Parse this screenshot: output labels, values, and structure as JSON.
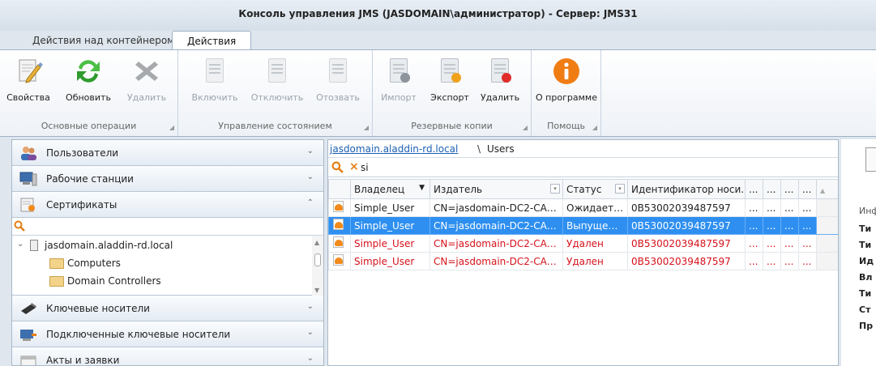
{
  "app": {
    "title": "Консоль управления JMS (JASDOMAIN\\администратор) - Сервер: JMS31"
  },
  "tabs": [
    {
      "label": "Действия над контейнером"
    },
    {
      "label": "Действия"
    }
  ],
  "ribbon": {
    "groups": [
      {
        "label": "Основные операции",
        "buttons": [
          {
            "label": "Свойства"
          },
          {
            "label": "Обновить"
          },
          {
            "label": "Удалить"
          }
        ]
      },
      {
        "label": "Управление состоянием",
        "buttons": [
          {
            "label": "Включить"
          },
          {
            "label": "Отключить"
          },
          {
            "label": "Отозвать"
          }
        ]
      },
      {
        "label": "Резервные копии",
        "buttons": [
          {
            "label": "Импорт"
          },
          {
            "label": "Экспорт"
          },
          {
            "label": "Удалить"
          }
        ]
      },
      {
        "label": "Помощь",
        "buttons": [
          {
            "label": "О программе"
          }
        ]
      }
    ]
  },
  "nav": {
    "items": [
      {
        "label": "Пользователи"
      },
      {
        "label": "Рабочие станции"
      },
      {
        "label": "Сертификаты"
      },
      {
        "label": "Ключевые носители"
      },
      {
        "label": "Подключенные ключевые носители"
      },
      {
        "label": "Акты и заявки"
      }
    ],
    "tree": {
      "root": "jasdomain.aladdin-rd.local",
      "children": [
        "Computers",
        "Domain Controllers"
      ]
    }
  },
  "content": {
    "breadcrumb": {
      "link": "jasdomain.aladdin-rd.local",
      "separator": "\\",
      "current": "Users"
    },
    "filter_value": "si",
    "columns": [
      "Владелец",
      "Издатель",
      "Статус",
      "Идентификатор носи...",
      "...",
      "...",
      "...",
      "..."
    ],
    "rows": [
      {
        "owner": "Simple_User",
        "issuer": "CN=jasdomain-DC2-CA, D...",
        "status": "Ожидает ...",
        "token_id": "0B53002039487597",
        "c1": "...",
        "c2": "...",
        "c3": "...",
        "c4": "..."
      },
      {
        "owner": "Simple_User",
        "issuer": "CN=jasdomain-DC2-CA, D...",
        "status": "Выпущен ...",
        "token_id": "0B53002039487597",
        "c1": "...",
        "c2": "...",
        "c3": "...",
        "c4": "..."
      },
      {
        "owner": "Simple_User",
        "issuer": "CN=jasdomain-DC2-CA, D...",
        "status": "Удален",
        "token_id": "0B53002039487597",
        "c1": "...",
        "c2": "...",
        "c3": "...",
        "c4": "..."
      },
      {
        "owner": "Simple_User",
        "issuer": "CN=jasdomain-DC2-CA, D...",
        "status": "Удален",
        "token_id": "0B53002039487597",
        "c1": "...",
        "c2": "...",
        "c3": "...",
        "c4": "..."
      }
    ]
  },
  "details": {
    "info": "Инф",
    "labels": [
      "Ти",
      "Ти",
      "Ид",
      "Вл",
      "Ти",
      "Ст",
      "Пр"
    ]
  }
}
